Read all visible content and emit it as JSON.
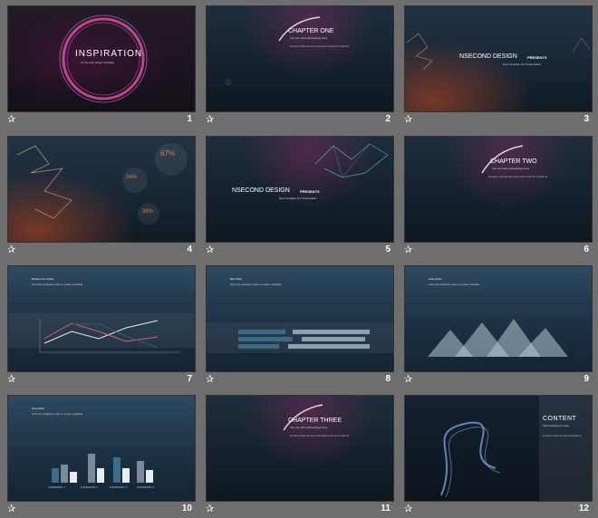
{
  "slides": [
    {
      "number": "1",
      "title": "INSPIRATION",
      "subtitle": "for the next project template"
    },
    {
      "number": "2",
      "title": "CHAPTER ONE",
      "subtitle": "You can add subheadings here"
    },
    {
      "number": "3",
      "title": "NSECOND DESIGN",
      "title_suffix": "PRESENTS",
      "subtitle": "New Template For Presentation"
    },
    {
      "number": "4",
      "stat_1": "67%",
      "stat_2": "34%",
      "stat_3": "38%"
    },
    {
      "number": "5",
      "title": "NSECOND DESIGN",
      "title_suffix": "PRESENTS",
      "subtitle": "New Template For Presentation"
    },
    {
      "number": "6",
      "title": "CHAPTER TWO",
      "subtitle": "You can add subheadings here"
    },
    {
      "number": "7",
      "heading": "Broken Line Chart",
      "description": "enter the analysis notes or power possible."
    },
    {
      "number": "8",
      "heading": "Bar Chart",
      "description": "enter the analysis notes or power possible."
    },
    {
      "number": "9",
      "heading": "Area Chart",
      "description": "enter the analysis notes or power possible."
    },
    {
      "number": "10",
      "heading": "Line Chart",
      "description": "enter the analysis notes or power possible.",
      "categories": [
        "CATEGORY 1",
        "CATEGORY 2",
        "CATEGORY 3",
        "CATEGORY 4"
      ]
    },
    {
      "number": "11",
      "title": "CHAPTER THREE",
      "subtitle": "You can add subheadings here"
    },
    {
      "number": "12",
      "title": "CONTENT",
      "subtitle": "Add heading text here"
    }
  ],
  "star_glyph": "✰",
  "colors": {
    "background": "#6e6e6e",
    "accent_pink": "#d9478f",
    "accent_teal": "#4fb3c9",
    "accent_orange": "#e07a3a"
  }
}
